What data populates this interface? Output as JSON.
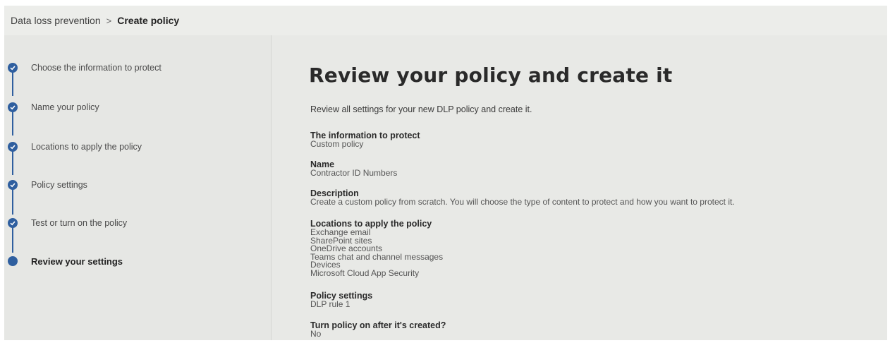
{
  "breadcrumb": {
    "parent": "Data loss prevention",
    "separator": ">",
    "current": "Create policy"
  },
  "wizard": {
    "steps": [
      {
        "label": "Choose the information to protect",
        "state": "completed"
      },
      {
        "label": "Name your policy",
        "state": "completed"
      },
      {
        "label": "Locations to apply the policy",
        "state": "completed"
      },
      {
        "label": "Policy settings",
        "state": "completed"
      },
      {
        "label": "Test or turn on the policy",
        "state": "completed"
      },
      {
        "label": "Review your settings",
        "state": "current"
      }
    ]
  },
  "review": {
    "title": "Review your policy and create it",
    "intro": "Review all settings for your new DLP policy and create it.",
    "sections": [
      {
        "heading": "The information to protect",
        "values": [
          "Custom policy"
        ]
      },
      {
        "heading": "Name",
        "values": [
          "Contractor ID Numbers"
        ]
      },
      {
        "heading": "Description",
        "values": [
          "Create a custom policy from scratch. You will choose the type of content to protect and how you want to protect it."
        ]
      },
      {
        "heading": "Locations to apply the policy",
        "values": [
          "Exchange email",
          "SharePoint sites",
          "OneDrive accounts",
          "Teams chat and channel messages",
          "Devices",
          "Microsoft Cloud App Security"
        ]
      },
      {
        "heading": "Policy settings",
        "values": [
          "DLP rule 1"
        ]
      },
      {
        "heading": "Turn policy on after it's created?",
        "values": [
          "No"
        ]
      }
    ]
  },
  "colors": {
    "accent": "#2f5f9f",
    "background": "#e8e9e6"
  }
}
